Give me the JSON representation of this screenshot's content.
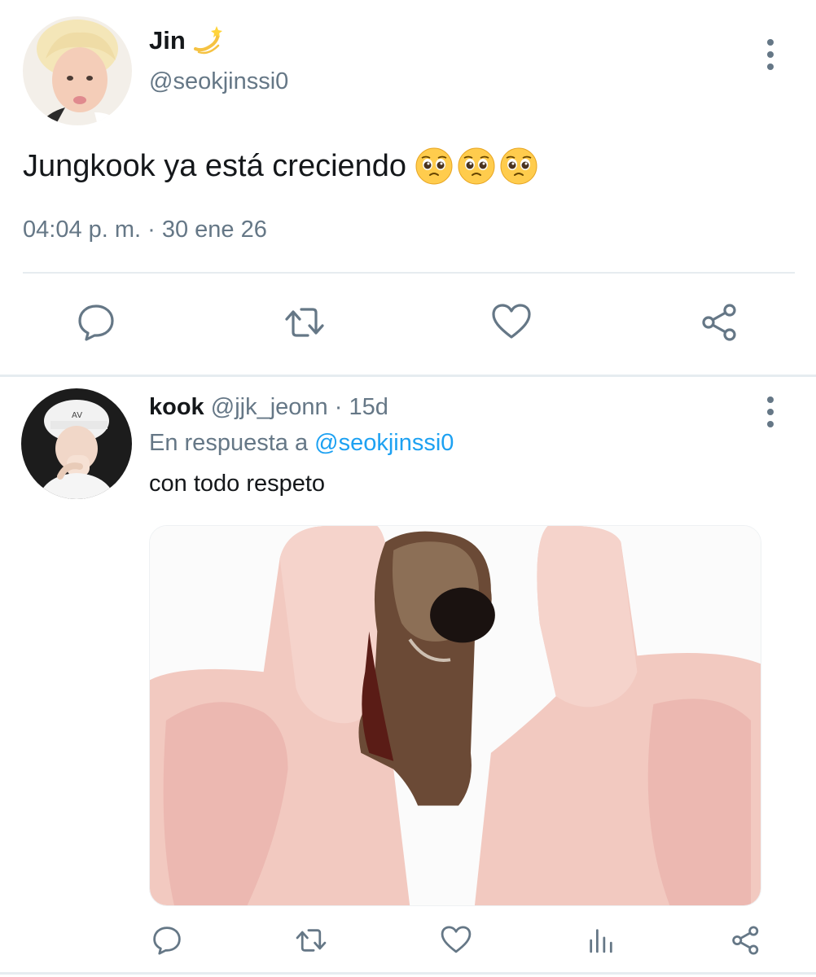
{
  "main_tweet": {
    "display_name": "Jin",
    "name_emoji_icon": "dizzy-emoji-icon",
    "handle": "@seokjinssi0",
    "text": "Jungkook ya está creciendo",
    "text_emoji_icons": [
      "pleading-face-emoji-icon",
      "pleading-face-emoji-icon",
      "pleading-face-emoji-icon"
    ],
    "timestamp": "04:04 p. m. · 30 ene 26",
    "actions": [
      "reply-icon",
      "retweet-icon",
      "like-icon",
      "share-icon"
    ]
  },
  "reply_tweet": {
    "display_name": "kook",
    "handle": "@jjk_jeonn",
    "age": "· 15d",
    "in_reply_prefix": "En respuesta a",
    "in_reply_mention": "@seokjinssi0",
    "text": "con todo respeto",
    "media": "image: two hands showing middle fingers with a small animal figure in the middle",
    "actions": [
      "reply-icon",
      "retweet-icon",
      "like-icon",
      "analytics-icon",
      "share-icon"
    ]
  },
  "colors": {
    "text_primary": "#14171a",
    "text_secondary": "#657786",
    "mention": "#1da1f2",
    "icon": "#657786",
    "divider": "#e6ecf0"
  }
}
